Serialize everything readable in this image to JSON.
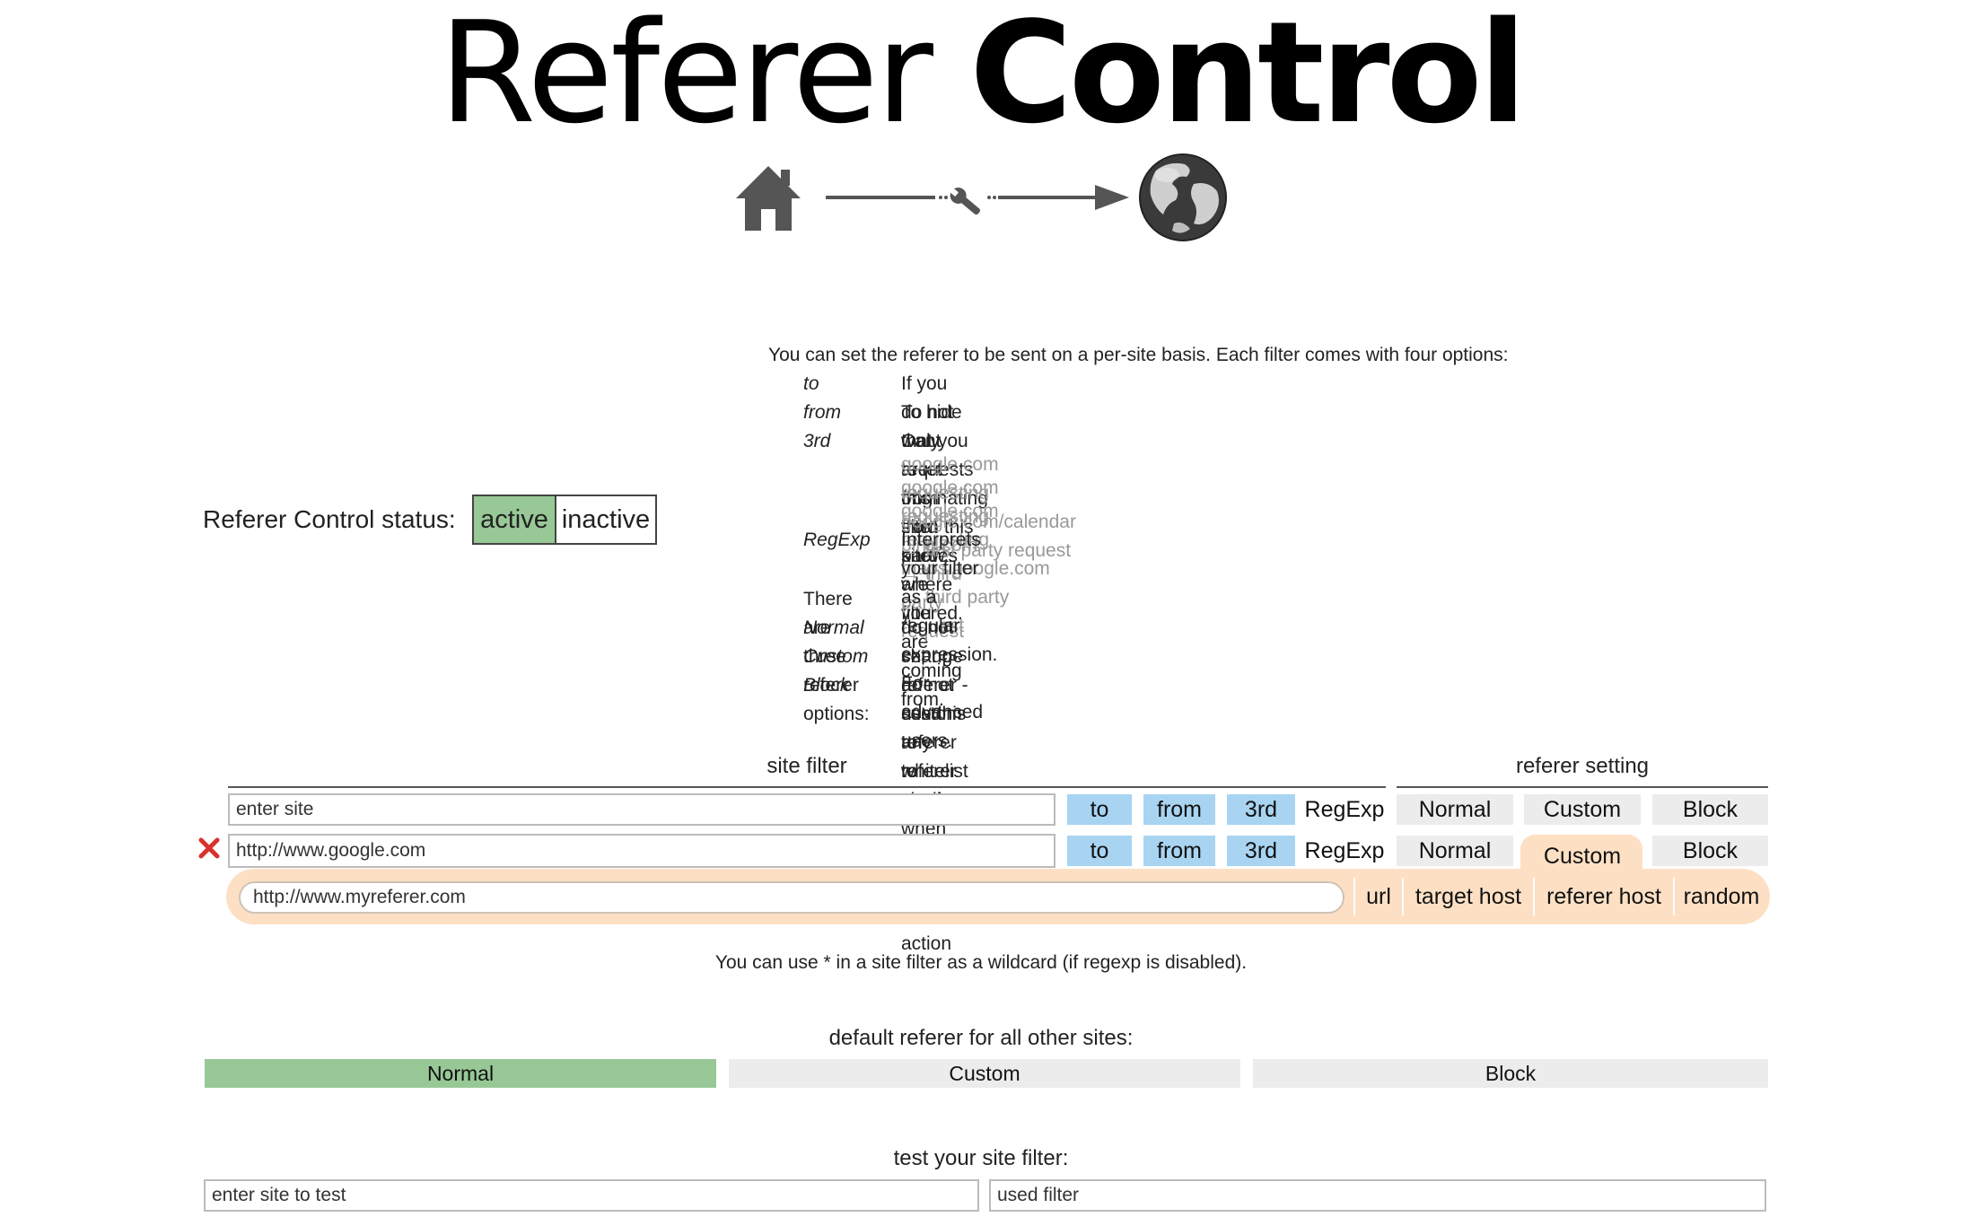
{
  "header": {
    "title_light": "Referer",
    "title_bold": "Control"
  },
  "status": {
    "label": "Referer Control status:",
    "active_label": "active",
    "inactive_label": "inactive",
    "selected": "active"
  },
  "info": {
    "intro": "You can set the referer to be sent on a per-site basis. Each filter comes with four options:",
    "filter_options": [
      {
        "key": "to",
        "desc": "If you do not want to let this site know where you are coming from."
      },
      {
        "key": "from",
        "desc": "To hide that you are originating from this site."
      },
      {
        "key": "3rd",
        "desc": "Only requests from third parties are filtered."
      },
      {
        "key": "RegExp",
        "desc": "Interprets your filter as a regular expression. For advanced users."
      }
    ],
    "examples": [
      "google.com requesting google.com/calendar → first party request",
      "google.com requesting bing.com → third party request",
      "google.com requesting maps.google.com → third party request"
    ],
    "referer_intro": "There are three referer options:",
    "referer_options": [
      {
        "key": "Normal",
        "desc": "do not change referer - use this to whitelist sites when using the default action"
      },
      {
        "key": "Custom",
        "desc": "set up a custom referer to send"
      },
      {
        "key": "Block",
        "desc": "do not send any referer at all"
      }
    ]
  },
  "table": {
    "site_filter_header": "site filter",
    "referer_setting_header": "referer setting",
    "new_row": {
      "placeholder": "enter site",
      "value": "",
      "to": "to",
      "from": "from",
      "third": "3rd",
      "regexp": "RegExp",
      "normal": "Normal",
      "custom": "Custom",
      "block": "Block"
    },
    "rows": [
      {
        "site": "http://www.google.com",
        "to": "to",
        "from": "from",
        "third": "3rd",
        "regexp": "RegExp",
        "normal": "Normal",
        "custom": "Custom",
        "block": "Block",
        "selected_referer": "Custom",
        "custom_referer": "http://www.myreferer.com",
        "custom_modes": [
          "url",
          "target host",
          "referer host",
          "random"
        ]
      }
    ]
  },
  "wildcard_note": "You can use * in a site filter as a wildcard (if regexp is disabled).",
  "default": {
    "label": "default referer for all other sites:",
    "options": [
      "Normal",
      "Custom",
      "Block"
    ],
    "selected": "Normal"
  },
  "test": {
    "label": "test your site filter:",
    "site_placeholder": "enter site to test",
    "used_filter_placeholder": "used filter"
  },
  "colors": {
    "active_green": "#98c896",
    "option_blue": "#a8d4f2",
    "option_grey": "#ececec",
    "custom_peach": "#fde0c4",
    "delete_red": "#d9322b"
  },
  "icons": [
    "home-icon",
    "wrench-icon",
    "arrow-right-icon",
    "globe-icon",
    "delete-icon"
  ]
}
